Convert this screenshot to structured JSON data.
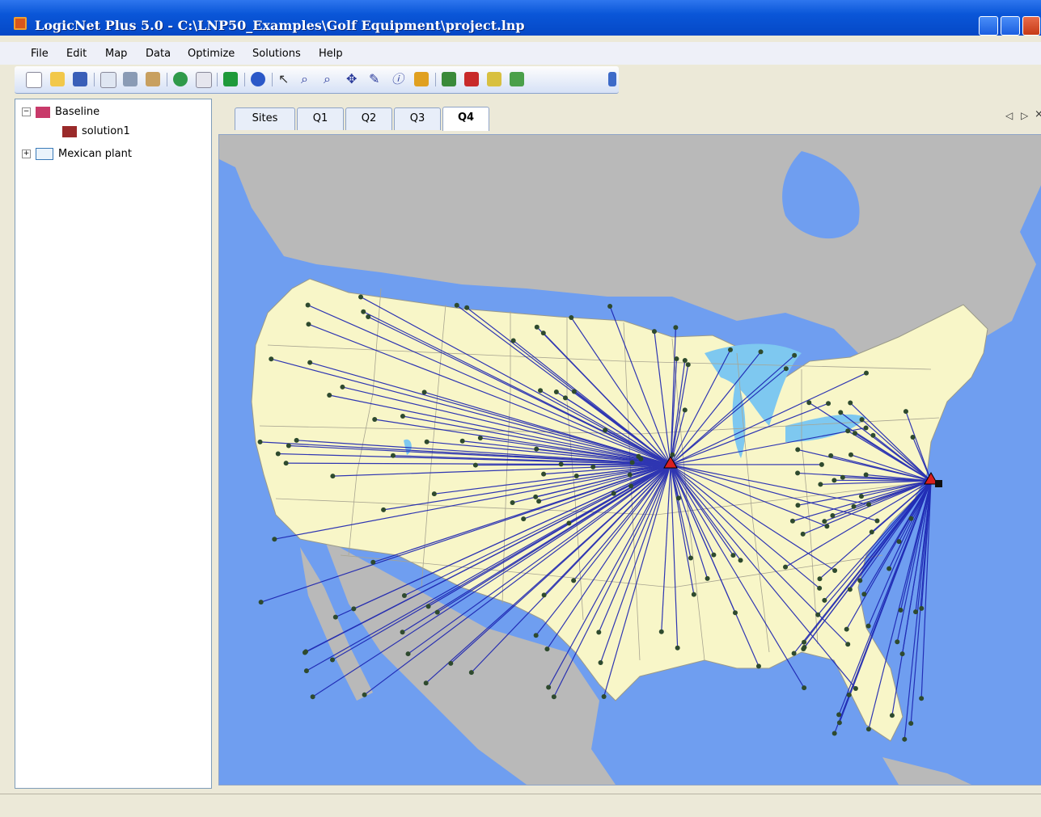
{
  "window": {
    "title": "LogicNet Plus 5.0 - C:\\LNP50_Examples\\Golf Equipment\\project.lnp"
  },
  "menu": [
    "File",
    "Edit",
    "Map",
    "Data",
    "Optimize",
    "Solutions",
    "Help"
  ],
  "toolbar": [
    "new",
    "open",
    "save",
    "copy",
    "cut",
    "paste",
    "globe",
    "image",
    "export",
    "help",
    "pointer",
    "zoom-in",
    "zoom-out",
    "pan",
    "pencil",
    "info",
    "wrench",
    "add",
    "delete",
    "edit",
    "grid"
  ],
  "tree": {
    "items": [
      {
        "label": "Baseline",
        "expanded": true
      },
      {
        "label": "solution1"
      },
      {
        "label": "Mexican plant",
        "expanded": false
      }
    ]
  },
  "tabs": [
    {
      "label": "Sites"
    },
    {
      "label": "Q1"
    },
    {
      "label": "Q2"
    },
    {
      "label": "Q3"
    },
    {
      "label": "Q4",
      "active": true
    }
  ],
  "tab_nav": {
    "prev": "◁",
    "next": "▷",
    "close": "×"
  },
  "colors": {
    "water": "#6f9ef0",
    "land": "#f8f6c8",
    "route": "#1a22b0",
    "site": "#2e4a2e",
    "facility": "#d82020"
  }
}
